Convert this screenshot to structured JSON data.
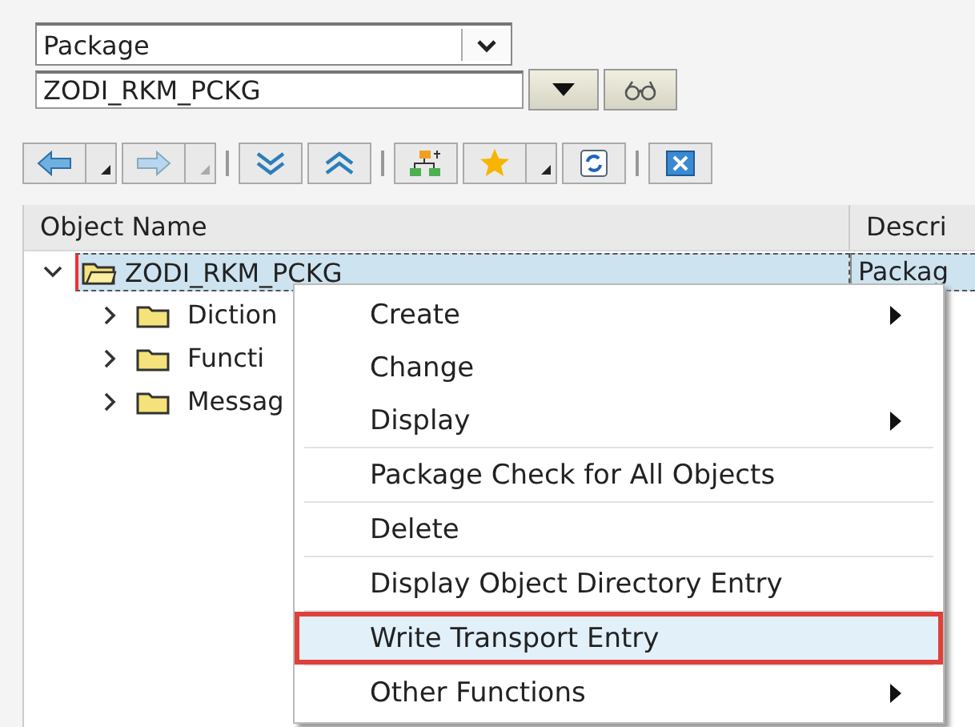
{
  "object_type_dropdown": {
    "value": "Package"
  },
  "object_name_field": {
    "value": "ZODI_RKM_PCKG"
  },
  "tree": {
    "columns": [
      "Object Name",
      "Descri"
    ],
    "rows": [
      {
        "name": "ZODI_RKM_PCKG",
        "description": "Packag",
        "expanded": true,
        "selected": true,
        "children": [
          {
            "name": "Diction",
            "expanded": false
          },
          {
            "name": "Functi",
            "expanded": false
          },
          {
            "name": "Messag",
            "expanded": false
          }
        ]
      }
    ]
  },
  "context_menu": {
    "groups": [
      [
        {
          "label": "Create",
          "submenu": true,
          "selected": false
        },
        {
          "label": "Change",
          "submenu": false,
          "selected": false
        },
        {
          "label": "Display",
          "submenu": true,
          "selected": false
        }
      ],
      [
        {
          "label": "Package Check for All Objects",
          "submenu": false,
          "selected": false
        }
      ],
      [
        {
          "label": "Delete",
          "submenu": false,
          "selected": false
        }
      ],
      [
        {
          "label": "Display Object Directory Entry",
          "submenu": false,
          "selected": false
        }
      ],
      [
        {
          "label": "Write Transport Entry",
          "submenu": false,
          "selected": true
        }
      ],
      [
        {
          "label": "Other Functions",
          "submenu": true,
          "selected": false
        }
      ]
    ]
  }
}
